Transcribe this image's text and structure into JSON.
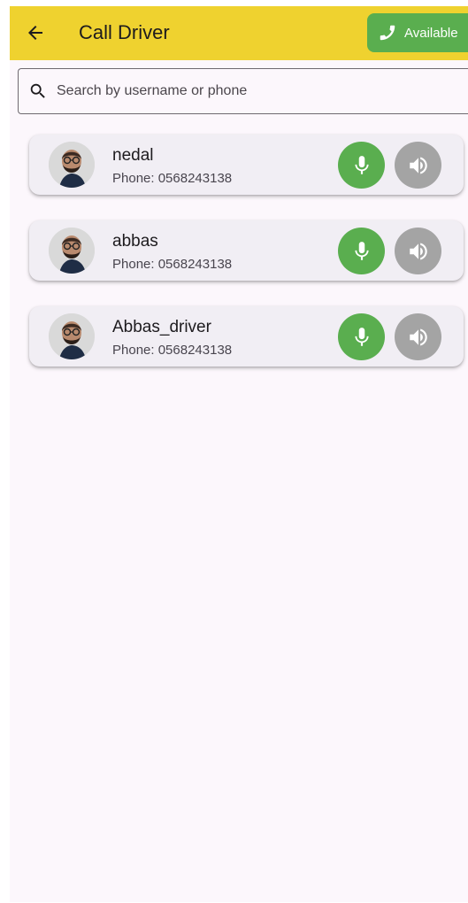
{
  "appbar": {
    "title": "Call Driver",
    "available_label": "Available",
    "background": "#efd22f",
    "icons": {
      "back": "arrow-back-icon",
      "phone": "phone-icon"
    }
  },
  "search": {
    "value": "",
    "placeholder": "Search by username or phone",
    "icon": "search-icon"
  },
  "drivers": [
    {
      "name": "nedal",
      "phone": "Phone: 0568243138"
    },
    {
      "name": "abbas",
      "phone": "Phone: 0568243138"
    },
    {
      "name": "Abbas_driver",
      "phone": "Phone: 0568243138"
    }
  ],
  "row_icons": {
    "mic": "microphone-icon",
    "speaker": "speaker-icon"
  },
  "colors": {
    "available_green": "#5aae4f",
    "mic_green": "#5aae4f",
    "speaker_grey": "#a4a4a4",
    "card_bg": "#f1eef4",
    "page_bg": "#fcf7fc"
  }
}
